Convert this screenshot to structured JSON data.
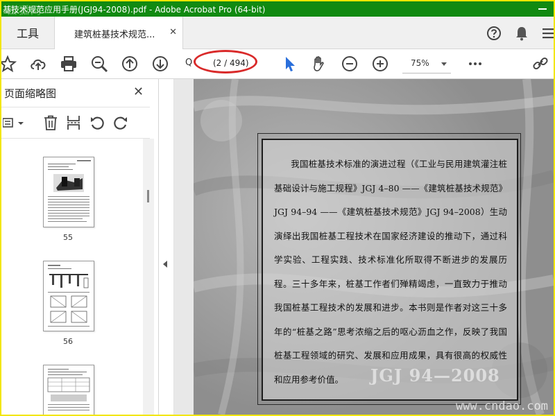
{
  "window": {
    "title": "基技术规范应用手册(JGJ94-2008).pdf - Adobe Acrobat Pro (64-bit)",
    "watermark": "西狐网"
  },
  "tabs": {
    "tools_label": "工具",
    "doc_label": "建筑桩基技术规范...",
    "doc_close": "✕"
  },
  "toolbar": {
    "page_display": "(2 / 494)",
    "search_prefix": "Q",
    "zoom_value": "75%"
  },
  "sidebar": {
    "title": "页面缩略图",
    "close": "✕",
    "thumbnails": [
      {
        "label": "55"
      },
      {
        "label": "56"
      },
      {
        "label": ""
      }
    ]
  },
  "document": {
    "paragraph": "我国桩基技术标准的演进过程（《工业与民用建筑灌注桩基础设计与施工规程》JGJ 4–80 ——《建筑桩基技术规范》JGJ 94–94 ——《建筑桩基技术规范》JGJ 94–2008）生动演绎出我国桩基工程技术在国家经济建设的推动下，通过科学实验、工程实践、技术标准化所取得不断进步的发展历程。三十多年来，桩基工作者们殚精竭虑，一直致力于推动我国桩基工程技术的发展和进步。本书则是作者对这三十多年的“桩基之路”思考浓缩之后的呕心沥血之作，反映了我国桩基工程领域的研究、发展和应用成果，具有很高的权威性和应用参考价值。",
    "stamp": "JGJ 94—2008",
    "site": "www.cndao.com"
  },
  "colors": {
    "titlebar": "#118a11",
    "highlight": "#d92a2a",
    "border": "#f2e600"
  }
}
